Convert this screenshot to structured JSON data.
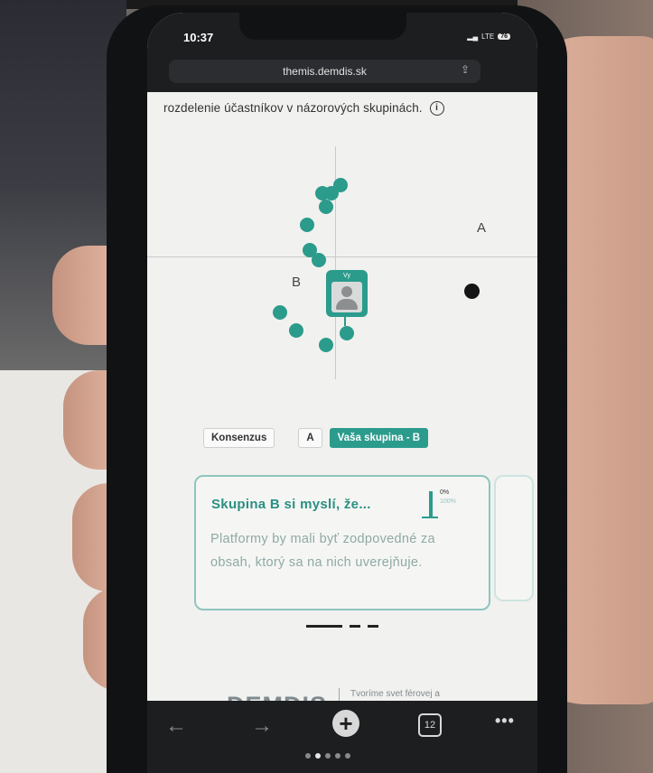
{
  "status": {
    "time": "10:37",
    "network": "LTE",
    "battery": "76"
  },
  "browser": {
    "url": "themis.demdis.sk",
    "tabs_count": "12",
    "more": "•••"
  },
  "page": {
    "heading": "rozdelenie účastníkov v názorových skupinách.",
    "info_glyph": "i",
    "group_a_label": "A",
    "group_b_label": "B",
    "avatar_label": "Vy",
    "tabs": {
      "consensus": "Konsenzus",
      "a": "A",
      "your_group": "Vaša skupina - B"
    },
    "card": {
      "title": "Skupina B si myslí, že...",
      "gauge_top": "0%",
      "gauge_bottom": "100%",
      "body": "Platformy by mali byť zodpovedné za obsah, ktorý sa na nich uverejňuje."
    },
    "footer": {
      "logo": "DEMDIS",
      "tagline": "Tvoríme svet férovej a otvorenej diskusie"
    }
  },
  "colors": {
    "accent": "#2b9b8c",
    "accent_light": "#8ec5bd",
    "chrome": "#1d1e20"
  }
}
